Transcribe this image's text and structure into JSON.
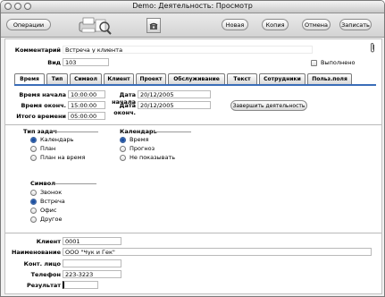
{
  "window": {
    "title": "Demo: Деятельность: Просмотр"
  },
  "toolbar": {
    "operations_label": "Операции",
    "new_label": "Новая",
    "copy_label": "Копия",
    "cancel_label": "Отмена",
    "save_label": "Записать"
  },
  "header": {
    "comment_label": "Комментарий",
    "comment_value": "Встреча у клиента",
    "type_label": "Вид",
    "type_value": "103",
    "done_label": "Выполнено",
    "done_checked": false
  },
  "tabs": [
    "Время",
    "Тип",
    "Символ",
    "Клиент",
    "Проект",
    "Обслуживание",
    "Текст",
    "Сотрудники",
    "Польз.поля"
  ],
  "active_tab": "Время",
  "time": {
    "start_time_label": "Время начала",
    "start_time": "10:00:00",
    "end_time_label": "Время оконч.",
    "end_time": "15:00:00",
    "total_label": "Итого времени",
    "total": "05:00:00",
    "start_date_label": "Дата начала",
    "start_date": "20/12/2005",
    "end_date_label": "Дата оконч.",
    "end_date": "20/12/2005",
    "finish_button": "Завершить деятельность"
  },
  "task_type": {
    "title": "Тип задач",
    "options": [
      "Календарь",
      "План",
      "План на время"
    ],
    "selected": 0
  },
  "calendar": {
    "title": "Календарь",
    "options": [
      "Время",
      "Прогноз",
      "Не показывать"
    ],
    "selected": 0
  },
  "symbol": {
    "title": "Символ",
    "options": [
      "Звонок",
      "Встреча",
      "Офис",
      "Другое"
    ],
    "selected": 1
  },
  "client": {
    "client_label": "Клиент",
    "client_value": "0001",
    "name_label": "Наименование",
    "name_value": "ООО \"Чук и Гек\"",
    "contact_label": "Конт. лицо",
    "contact_value": "",
    "phone_label": "Телефон",
    "phone_value": "223-3223",
    "result_label": "Результат",
    "result_value": ""
  }
}
